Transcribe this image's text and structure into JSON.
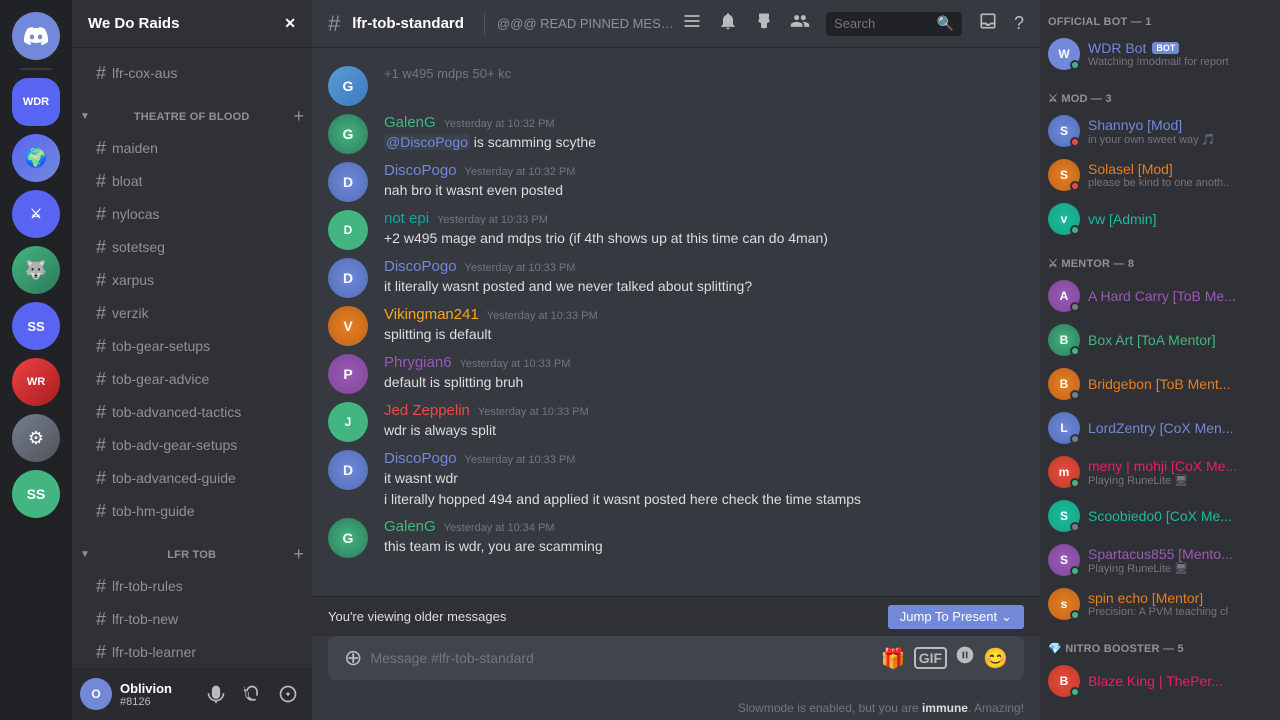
{
  "app": {
    "title": "Discord"
  },
  "server_list": {
    "servers": [
      {
        "id": "discord-home",
        "label": "Discord Home",
        "icon_text": "💬",
        "color": "#7289da"
      },
      {
        "id": "ss",
        "label": "SS",
        "icon_text": "SS",
        "color": "#43b581"
      },
      {
        "id": "server1",
        "label": "Server 1",
        "icon_text": "🌍",
        "color": "#5865f2"
      },
      {
        "id": "server2",
        "label": "Server 2",
        "icon_text": "⚔",
        "color": "#ed4245"
      },
      {
        "id": "server3",
        "label": "Server 3",
        "icon_text": "🐺",
        "color": "#faa61a"
      },
      {
        "id": "server4",
        "label": "Server 4",
        "icon_text": "WR",
        "color": "#5865f2"
      },
      {
        "id": "server5",
        "label": "Server 5",
        "icon_text": "⚙",
        "color": "#36393f"
      }
    ]
  },
  "sidebar": {
    "server_name": "We Do Raids",
    "sections": [
      {
        "type": "channel",
        "name": "lfr-cox-aus",
        "prefix": "#"
      },
      {
        "type": "category",
        "name": "THEATRE OF BLOOD",
        "channels": [
          {
            "name": "maiden"
          },
          {
            "name": "bloat"
          },
          {
            "name": "nylocas"
          },
          {
            "name": "sotetseg"
          },
          {
            "name": "xarpus"
          },
          {
            "name": "verzik"
          },
          {
            "name": "tob-gear-setups"
          },
          {
            "name": "tob-gear-advice"
          },
          {
            "name": "tob-advanced-tactics"
          },
          {
            "name": "tob-adv-gear-setups"
          },
          {
            "name": "tob-advanced-guide"
          },
          {
            "name": "tob-hm-guide"
          }
        ]
      },
      {
        "type": "category",
        "name": "LFR TOB",
        "channels": [
          {
            "name": "lfr-tob-rules"
          },
          {
            "name": "lfr-tob-new"
          },
          {
            "name": "lfr-tob-learner"
          },
          {
            "name": "lfr-tob-standard",
            "active": true
          }
        ]
      }
    ],
    "user": {
      "name": "Oblivion",
      "discriminator": "#8126",
      "avatar_color": "#7289da",
      "avatar_text": "O"
    }
  },
  "channel_header": {
    "name": "lfr-tob-standard",
    "topic": "@@@  READ PINNED MESSAGES !!!!  @@@  ====================>",
    "search_placeholder": "Search"
  },
  "messages": [
    {
      "id": "msg1",
      "author": "GalenG",
      "author_color": "color-green",
      "avatar_color": "green-avatar",
      "avatar_text": "G",
      "timestamp": "Yesterday at 10:32 PM",
      "text": "@DiscoPogo is scamming scythe",
      "mention": "@DiscoPogo"
    },
    {
      "id": "msg2",
      "author": "DiscoPogo",
      "author_color": "color-blue",
      "avatar_color": "blue-avatar",
      "avatar_text": "D",
      "timestamp": "Yesterday at 10:32 PM",
      "text": "nah bro it wasnt even posted"
    },
    {
      "id": "msg3",
      "author": "not epi",
      "author_color": "color-teal",
      "avatar_color": "discord-green",
      "avatar_text": "D",
      "timestamp": "Yesterday at 10:33 PM",
      "text": "+2 w495 mage and mdps trio (if 4th shows up at this time can do 4man)"
    },
    {
      "id": "msg4",
      "author": "DiscoPogo",
      "author_color": "color-blue",
      "avatar_color": "blue-avatar",
      "avatar_text": "D",
      "timestamp": "Yesterday at 10:33 PM",
      "text": "it literally wasnt posted and we never talked about splitting?"
    },
    {
      "id": "msg5",
      "author": "Vikingman241",
      "author_color": "color-orange",
      "avatar_color": "orange-avatar",
      "avatar_text": "V",
      "timestamp": "Yesterday at 10:33 PM",
      "text": "splitting is default"
    },
    {
      "id": "msg6",
      "author": "Phrygian6",
      "author_color": "color-purple",
      "avatar_color": "purple-avatar",
      "avatar_text": "P",
      "timestamp": "Yesterday at 10:33 PM",
      "text": "default is splitting bruh"
    },
    {
      "id": "msg7",
      "author": "Jed Zeppelin",
      "author_color": "color-red",
      "avatar_color": "discord-green",
      "avatar_text": "J",
      "timestamp": "Yesterday at 10:33 PM",
      "text": "wdr is always split"
    },
    {
      "id": "msg8",
      "author": "DiscoPogo",
      "author_color": "color-blue",
      "avatar_color": "blue-avatar",
      "avatar_text": "D",
      "timestamp": "Yesterday at 10:33 PM",
      "text": "it wasnt wdr",
      "continuation": "i literally hopped 494 and applied it wasnt posted here check the time stamps"
    },
    {
      "id": "msg9",
      "author": "GalenG",
      "author_color": "color-green",
      "avatar_color": "green-avatar",
      "avatar_text": "G",
      "timestamp": "Yesterday at 10:34 PM",
      "text": "this team is wdr, you are scamming"
    }
  ],
  "older_messages_bar": {
    "text": "You're viewing older messages",
    "button": "Jump To Present"
  },
  "message_input": {
    "placeholder": "Message #lfr-tob-standard"
  },
  "slowmode": {
    "text": "Slowmode is enabled, but you are immune. Amazing!"
  },
  "right_panel": {
    "sections": [
      {
        "id": "official-bot",
        "label": "OFFICIAL BOT",
        "count": 1,
        "members": [
          {
            "name": "WDR Bot",
            "is_bot": true,
            "subtext": "Watching !modmail for reports",
            "avatar_color": "#7289da",
            "avatar_text": "W",
            "status": "online",
            "name_color": "member-color-blue"
          }
        ]
      },
      {
        "id": "mod",
        "label": "MOD",
        "count": 3,
        "members": [
          {
            "name": "Shannyo [Mod]",
            "subtext": "in your own sweet way 🎵",
            "avatar_color": "blue-avatar",
            "avatar_text": "S",
            "status": "dnd",
            "name_color": "member-color-blue"
          },
          {
            "name": "Solasel [Mod]",
            "subtext": "please be kind to one anoth...",
            "avatar_color": "orange-avatar",
            "avatar_text": "S",
            "status": "dnd",
            "name_color": "member-color-orange"
          },
          {
            "name": "vw [Admin]",
            "subtext": "",
            "avatar_color": "teal-avatar",
            "avatar_text": "v",
            "status": "online",
            "name_color": "member-color-teal"
          }
        ]
      },
      {
        "id": "mentor",
        "label": "MENTOR",
        "count": 8,
        "members": [
          {
            "name": "A Hard Carry [ToB Me...",
            "subtext": "",
            "avatar_color": "purple-avatar",
            "avatar_text": "A",
            "status": "offline",
            "name_color": "member-color-purple"
          },
          {
            "name": "Box Art [ToA Mentor]",
            "subtext": "",
            "avatar_color": "green-avatar",
            "avatar_text": "B",
            "status": "online",
            "name_color": "member-color-green"
          },
          {
            "name": "Bridgebon [ToB Ment...",
            "subtext": "",
            "avatar_color": "orange-avatar",
            "avatar_text": "B",
            "status": "offline",
            "name_color": "member-color-orange"
          },
          {
            "name": "LordZentry [CoX Men...",
            "subtext": "",
            "avatar_color": "blue-avatar",
            "avatar_text": "L",
            "status": "offline",
            "name_color": "member-color-blue"
          },
          {
            "name": "meny | mohji [CoX Me...",
            "subtext": "Playing RuneLite 🖥",
            "avatar_color": "red-avatar",
            "avatar_text": "m",
            "status": "online",
            "name_color": "member-color-pink"
          },
          {
            "name": "Scoobiedo0 [CoX Me...",
            "subtext": "",
            "avatar_color": "teal-avatar",
            "avatar_text": "S",
            "status": "offline",
            "name_color": "member-color-teal"
          },
          {
            "name": "Spartacus855 [Mento...",
            "subtext": "Playing RuneLite 🖥",
            "avatar_color": "purple-avatar",
            "avatar_text": "S",
            "status": "online",
            "name_color": "member-color-purple"
          },
          {
            "name": "spin echo [Mentor]",
            "subtext": "Precision: A PVM teaching clan",
            "avatar_color": "orange-avatar",
            "avatar_text": "s",
            "status": "online",
            "name_color": "member-color-orange"
          }
        ]
      },
      {
        "id": "nitro-booster",
        "label": "NITRO BOOSTER",
        "count": 5,
        "members": [
          {
            "name": "Blaze King | ThePer...",
            "subtext": "",
            "avatar_color": "red-avatar",
            "avatar_text": "B",
            "status": "online",
            "name_color": "member-color-pink"
          }
        ]
      }
    ]
  }
}
